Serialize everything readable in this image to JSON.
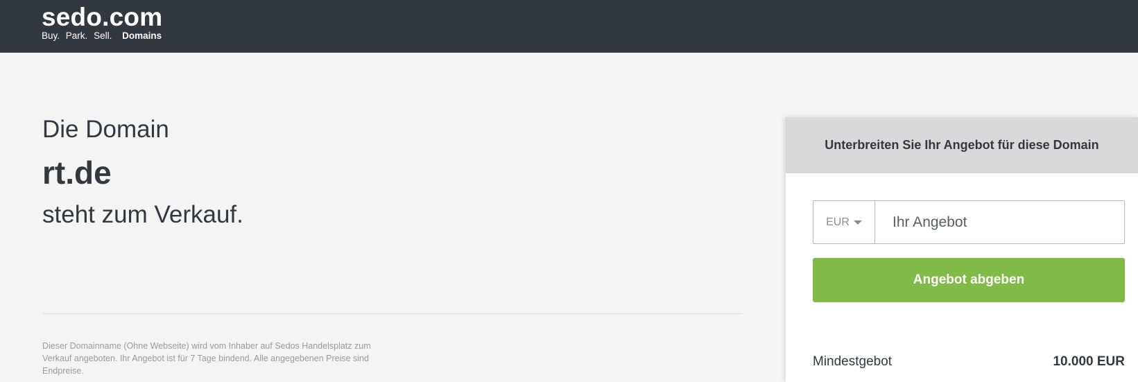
{
  "header": {
    "logo": "sedo.com",
    "tagline_words": [
      "Buy.",
      "Park.",
      "Sell."
    ],
    "tagline_bold": "Domains"
  },
  "intro": {
    "line1": "Die Domain",
    "domain": "rt.de",
    "line3": "steht zum Verkauf."
  },
  "disclaimer": "Dieser Domainname (Ohne Webseite) wird vom Inhaber auf Sedos Handelsplatz zum Verkauf angeboten. Ihr Angebot ist für 7 Tage bindend. Alle angegebenen Preise sind Endpreise.",
  "offer": {
    "heading": "Unterbreiten Sie Ihr Angebot für diese Domain",
    "currency": "EUR",
    "input_placeholder": "Ihr Angebot",
    "input_value": "",
    "submit_label": "Angebot abgeben",
    "min_label": "Mindestgebot",
    "min_value": "10.000 EUR"
  },
  "colors": {
    "header_bg": "#33373e",
    "page_bg": "#f4f4f4",
    "accent_green": "#7fbb46",
    "card_head_bg": "#d9d9d9"
  }
}
